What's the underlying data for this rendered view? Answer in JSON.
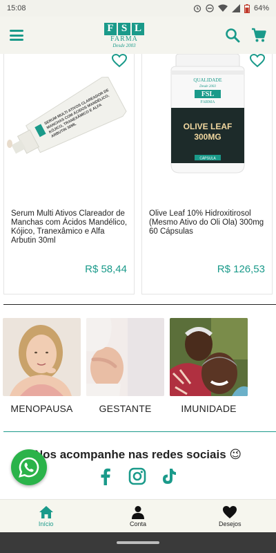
{
  "status_bar": {
    "time": "15:08",
    "battery": "64%"
  },
  "header": {
    "logo": {
      "letters": [
        "F",
        "S",
        "L"
      ],
      "sub": "FARMA",
      "since": "Desde 2003"
    }
  },
  "products": [
    {
      "name": "Serum Multi Ativos Clareador de Manchas com Ácidos Mandélico, Kójico, Tranexâmico e Alfa Arbutin 30ml",
      "price": "R$ 58,44",
      "tube_text": "SERUM MULTI ATIVOS CLAREADOR DE MANCHAS COM ÁCIDOS MANDÉLICO, KÓJICO, TRANEXÂMICO E ALFA ARBUTIN 30ML"
    },
    {
      "name": "Olive Leaf 10% Hidroxitirosol (Mesmo Ativo do Oli Ola) 300mg 60 Cápsulas",
      "price": "R$ 126,53",
      "bottle": {
        "qualidade": "QUALIDADE",
        "since": "Desde 2003",
        "brand": "FSL",
        "farma": "FARMA",
        "title_line1": "OLIVE LEAF",
        "title_line2": "300MG",
        "caps": "CÁPSULA"
      }
    }
  ],
  "categories": [
    {
      "label": "MENOPAUSA"
    },
    {
      "label": "GESTANTE"
    },
    {
      "label": "IMUNIDADE"
    }
  ],
  "social": {
    "title": "Nos acompanhe nas redes sociais 😉",
    "icons": [
      "facebook-icon",
      "instagram-icon",
      "tiktok-icon"
    ]
  },
  "bottom_nav": [
    {
      "label": "Início",
      "icon": "home-icon",
      "active": true
    },
    {
      "label": "Conta",
      "icon": "person-icon",
      "active": false
    },
    {
      "label": "Desejos",
      "icon": "heart-icon",
      "active": false
    }
  ],
  "colors": {
    "accent": "#1a9a8a",
    "price": "#1a9a8a",
    "whatsapp": "#2bb34a"
  }
}
